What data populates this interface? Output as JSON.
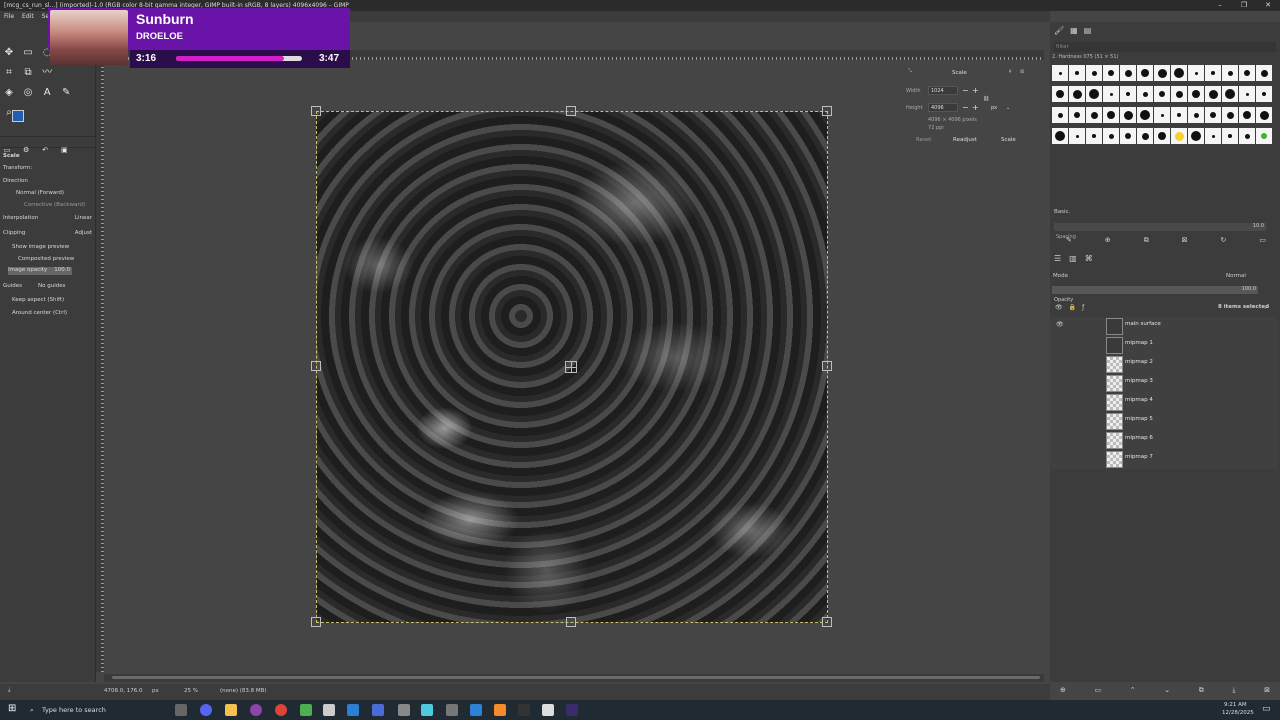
{
  "window": {
    "title": "[mcg_cs_run_sl...] (imported)-1.0 (RGB color 8-bit gamma integer, GIMP built-in sRGB, 8 layers) 4096x4096 – GIMP",
    "controls": [
      "–",
      "❐",
      "✕"
    ]
  },
  "menu": [
    "File",
    "Edit",
    "Select"
  ],
  "tool_options": {
    "title": "Scale",
    "transform_label": "Transform:",
    "direction_label": "Direction",
    "direction_options": [
      "Normal (Forward)",
      "Corrective (Backward)"
    ],
    "interpolation_label": "Interpolation",
    "interpolation_value": "Linear",
    "clipping_label": "Clipping",
    "clipping_value": "Adjust",
    "show_preview": "Show image preview",
    "composited_preview": "Composited preview",
    "image_opacity_label": "Image opacity",
    "image_opacity_value": "100.0",
    "guides_label": "Guides",
    "guides_value": "No guides",
    "keep_aspect": "Keep aspect (Shift)",
    "around_center": "Around center (Ctrl)"
  },
  "scale_dialog": {
    "title": "Scale",
    "width_label": "Width",
    "width_value": "1024",
    "height_label": "Height",
    "height_value": "4096",
    "unit": "px",
    "info_pixels": "4096 × 4096 pixels",
    "info_ppi": "72 ppi",
    "reset": "Reset",
    "readjust": "Readjust",
    "scale": "Scale"
  },
  "brushes": {
    "filter_placeholder": "filter",
    "current": "2. Hardness 075 (51 × 51)",
    "preset": "Basic.",
    "spacing_label": "Spacing",
    "spacing_value": "10.0"
  },
  "layers": {
    "mode_label": "Mode",
    "mode_value": "Normal",
    "opacity_label": "Opacity",
    "opacity_value": "100.0",
    "selected_info": "8 items selected",
    "items": [
      "main surface",
      "mipmap 1",
      "mipmap 2",
      "mipmap 3",
      "mipmap 4",
      "mipmap 5",
      "mipmap 6",
      "mipmap 7"
    ]
  },
  "status": {
    "coords": "4708.0, 176.0",
    "unit": "px",
    "zoom": "25 %",
    "info": "(none) (83.8 MB)"
  },
  "music": {
    "title": "Sunburn",
    "artist": "DROELOE",
    "current": "3:16",
    "total": "3:47",
    "progress": 0.86
  },
  "taskbar": {
    "search_placeholder": "Type here to search",
    "time": "9:21 AM",
    "date": "12/28/2025"
  },
  "colors": {
    "fg": "#1f5fb0",
    "bg": "#ffffff",
    "accent_music": "#6a13a8"
  }
}
